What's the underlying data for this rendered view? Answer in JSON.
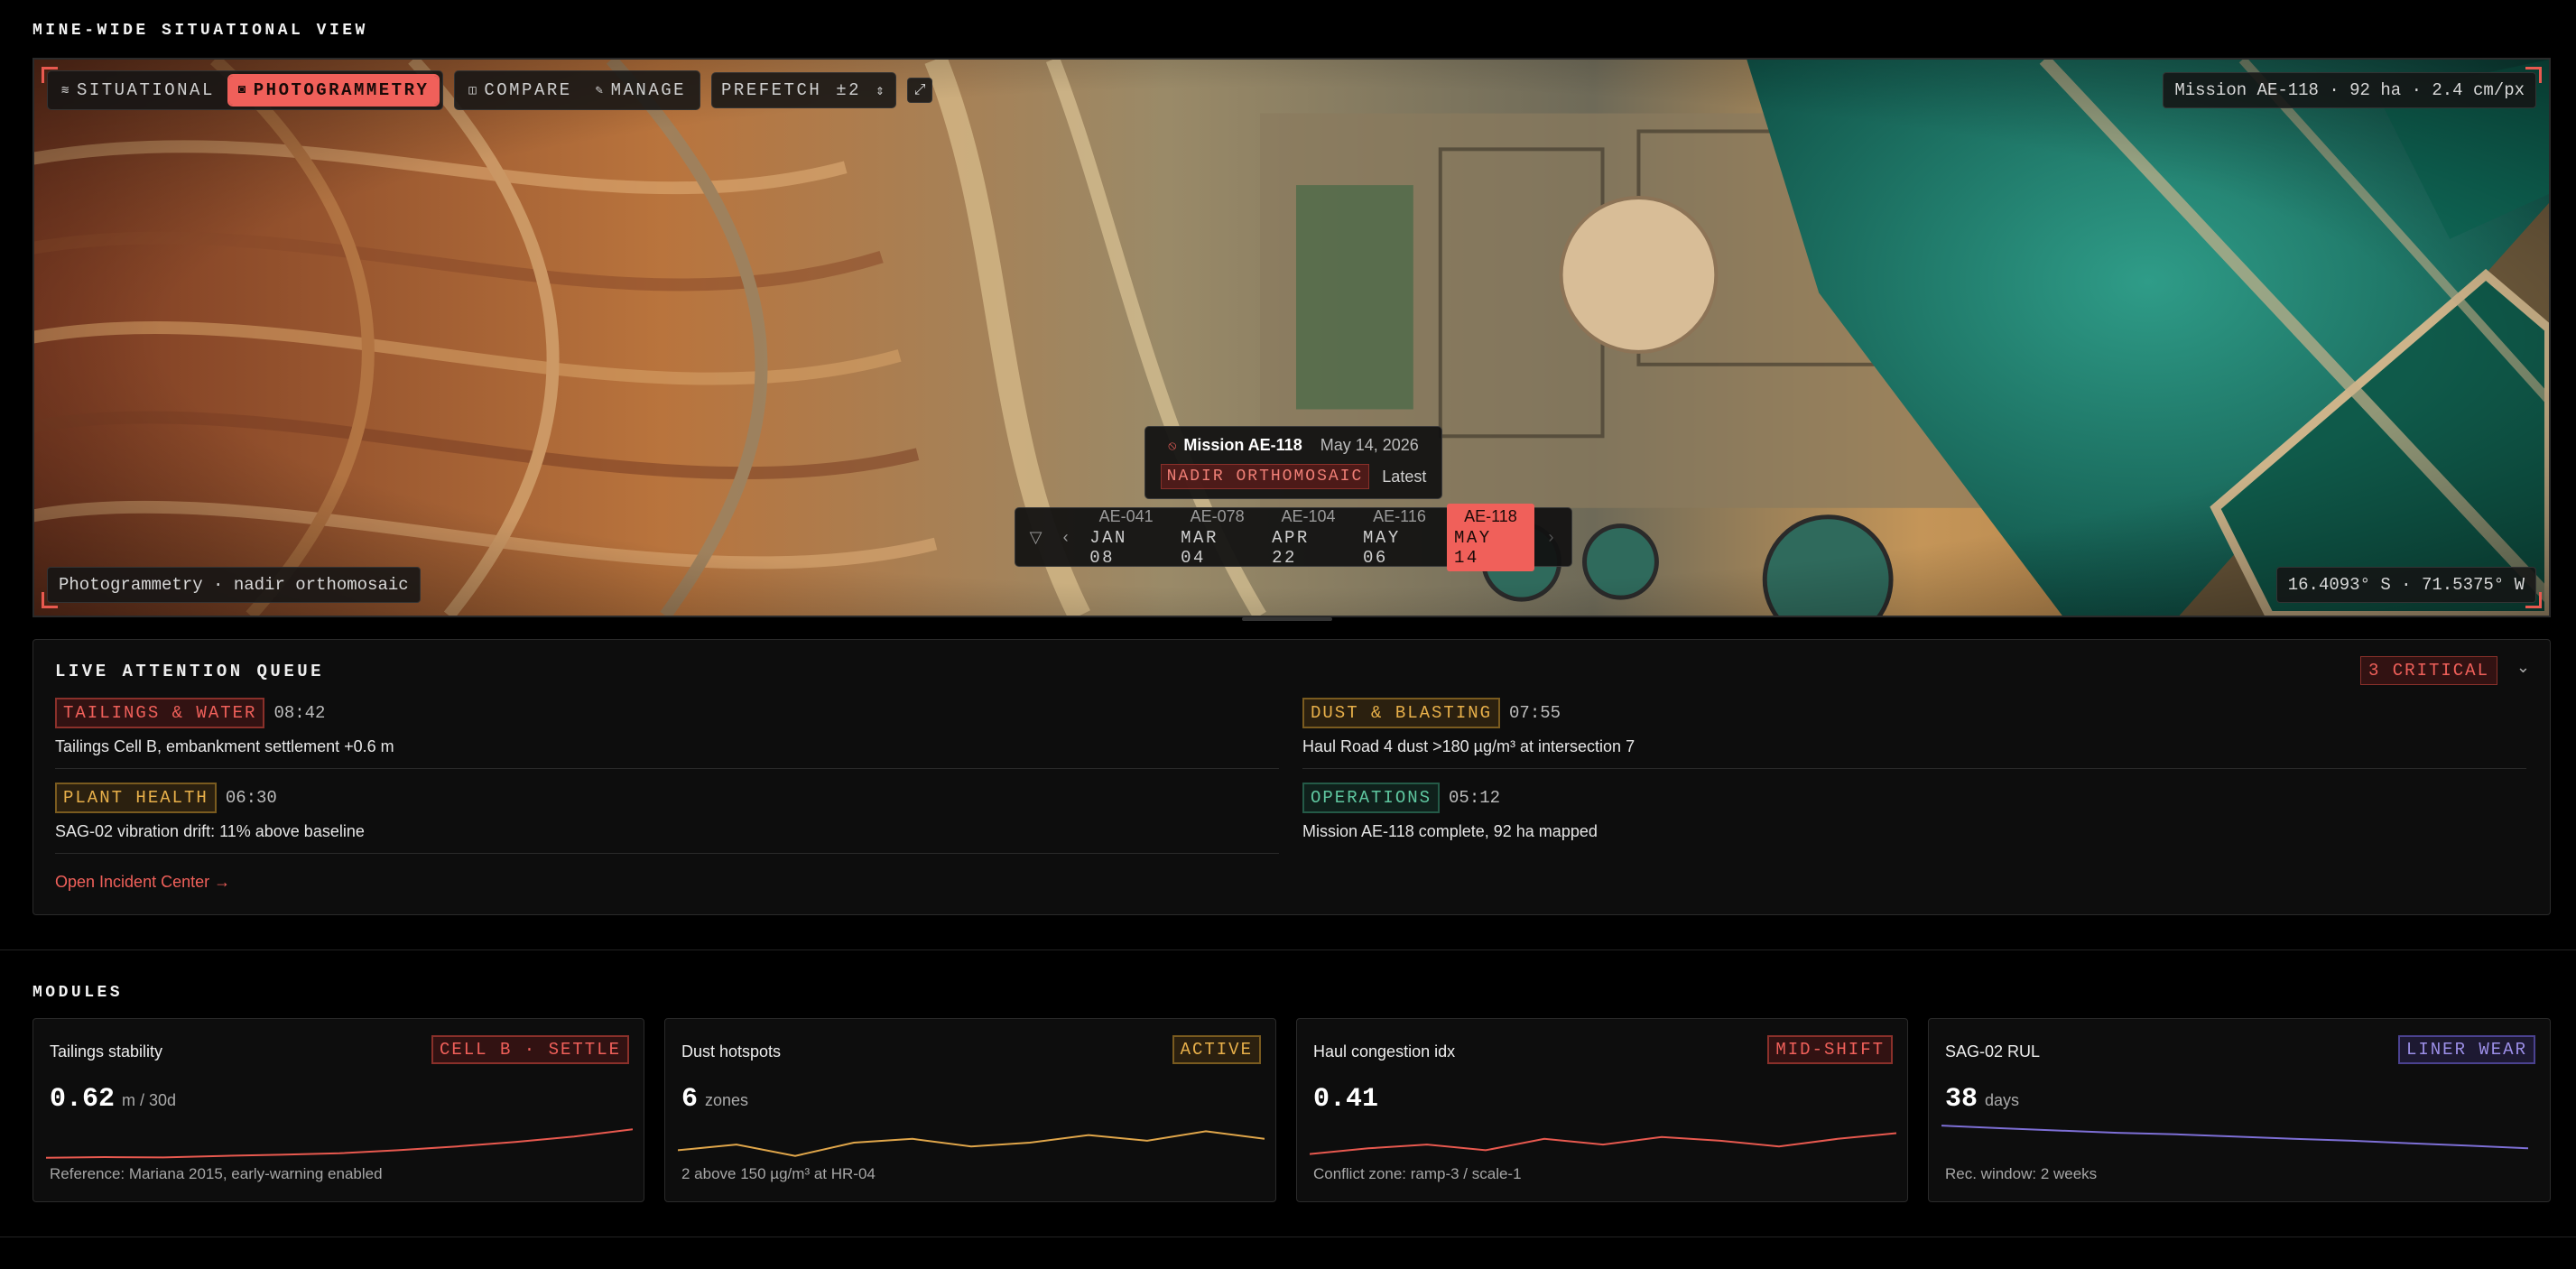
{
  "page": {
    "title": "MINE-WIDE SITUATIONAL VIEW"
  },
  "map": {
    "toolbar": {
      "modes": [
        {
          "label": "SITUATIONAL",
          "icon": "layers-icon"
        },
        {
          "label": "PHOTOGRAMMETRY",
          "icon": "camera-icon",
          "active": true
        }
      ],
      "tools": [
        {
          "label": "COMPARE",
          "icon": "compare-icon"
        },
        {
          "label": "MANAGE",
          "icon": "pencil-icon"
        }
      ],
      "prefetch_label": "PREFETCH",
      "prefetch_value": "±2"
    },
    "mission_info": "Mission AE-118 · 92 ha · 2.4 cm/px",
    "mode_label": "Photogrammetry · nadir orthomosaic",
    "coordinates": "16.4093° S · 71.5375° W",
    "tooltip": {
      "mission": "Mission AE-118",
      "date": "May 14, 2026",
      "product": "NADIR ORTHOMOSAIC",
      "status": "Latest"
    },
    "timeline": [
      {
        "code": "AE-041",
        "date": "JAN 08"
      },
      {
        "code": "AE-078",
        "date": "MAR 04"
      },
      {
        "code": "AE-104",
        "date": "APR 22"
      },
      {
        "code": "AE-116",
        "date": "MAY 06"
      },
      {
        "code": "AE-118",
        "date": "MAY 14",
        "active": true
      }
    ]
  },
  "queue": {
    "title": "LIVE ATTENTION QUEUE",
    "critical_badge": "3 CRITICAL",
    "items": [
      {
        "tag": "TAILINGS & WATER",
        "color": "red",
        "time": "08:42",
        "text": "Tailings Cell B, embankment settlement +0.6 m"
      },
      {
        "tag": "DUST & BLASTING",
        "color": "amber",
        "time": "07:55",
        "text": "Haul Road 4 dust >180 µg/m³ at intersection 7"
      },
      {
        "tag": "PLANT HEALTH",
        "color": "amber",
        "time": "06:30",
        "text": "SAG-02 vibration drift: 11% above baseline"
      },
      {
        "tag": "OPERATIONS",
        "color": "green",
        "time": "05:12",
        "text": "Mission AE-118 complete, 92 ha mapped"
      }
    ],
    "link": "Open Incident Center →"
  },
  "modules": {
    "title": "MODULES",
    "cards": [
      {
        "title": "Tailings stability",
        "badge": "CELL B · SETTLE",
        "badge_color": "red",
        "value": "0.62",
        "unit": "m / 30d",
        "footer": "Reference: Mariana 2015, early-warning enabled",
        "line_color": "#e8594f",
        "trend": [
          0.1,
          0.12,
          0.11,
          0.15,
          0.18,
          0.22,
          0.3,
          0.4,
          0.52,
          0.66,
          0.85
        ]
      },
      {
        "title": "Dust hotspots",
        "badge": "ACTIVE",
        "badge_color": "amber",
        "value": "6",
        "unit": "zones",
        "footer": "2 above 150 µg/m³ at HR-04",
        "line_color": "#e0a64a",
        "trend": [
          0.3,
          0.45,
          0.15,
          0.5,
          0.6,
          0.4,
          0.5,
          0.7,
          0.55,
          0.8,
          0.6
        ]
      },
      {
        "title": "Haul congestion idx",
        "badge": "MID-SHIFT",
        "badge_color": "red",
        "value": "0.41",
        "unit": "",
        "footer": "Conflict zone: ramp-3 / scale-1",
        "line_color": "#e8594f",
        "trend": [
          0.2,
          0.35,
          0.45,
          0.3,
          0.6,
          0.45,
          0.65,
          0.55,
          0.4,
          0.6,
          0.75
        ]
      },
      {
        "title": "SAG-02 RUL",
        "badge": "LINER WEAR",
        "badge_color": "purple",
        "value": "38",
        "unit": "days",
        "footer": "Rec. window: 2 weeks",
        "line_color": "#7d6fd6",
        "trend": [
          0.95,
          0.88,
          0.82,
          0.76,
          0.72,
          0.66,
          0.6,
          0.55,
          0.48,
          0.42,
          0.35
        ]
      }
    ]
  }
}
